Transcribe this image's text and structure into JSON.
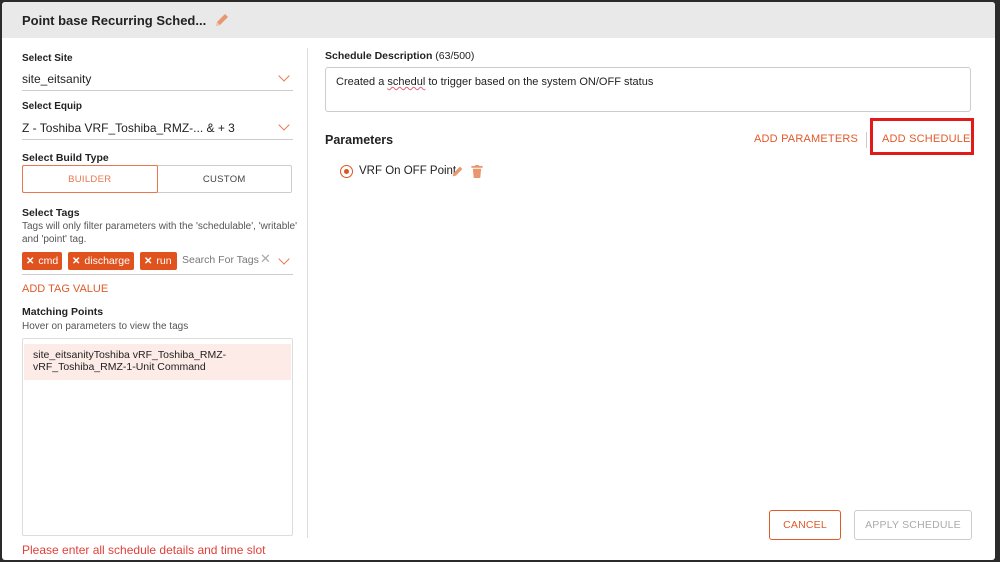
{
  "header": {
    "title": "Point base Recurring Sched..."
  },
  "left": {
    "site_label": "Select Site",
    "site_value": "site_eitsanity",
    "equip_label": "Select Equip",
    "equip_value": "Z - Toshiba VRF_Toshiba_RMZ-... & + 3",
    "build_label": "Select Build Type",
    "build_options": [
      "BUILDER",
      "CUSTOM"
    ],
    "tags_label": "Select Tags",
    "tags_hint": "Tags will only filter parameters with the 'schedulable', 'writable' and 'point' tag.",
    "tags": [
      "cmd",
      "discharge",
      "run"
    ],
    "tags_placeholder": "Search For Tags",
    "add_tag_value": "ADD TAG VALUE",
    "matching_label": "Matching Points",
    "matching_hint": "Hover on parameters to view the tags",
    "matching_points": [
      "site_eitsanityToshiba vRF_Toshiba_RMZ-vRF_Toshiba_RMZ-1-Unit Command"
    ],
    "error": "Please enter all schedule details and time slot value"
  },
  "right": {
    "desc_label": "Schedule Description",
    "desc_count": "(63/500)",
    "desc_before": "Created a ",
    "desc_misspelled": "schedul",
    "desc_after": " to trigger based on the system  ON/OFF status",
    "params_title": "Parameters",
    "add_parameters": "ADD PARAMETERS",
    "add_schedule": "ADD SCHEDULE",
    "parameter": "VRF On OFF Point",
    "cancel": "CANCEL",
    "apply": "APPLY SCHEDULE"
  },
  "colors": {
    "accent": "#e05a2a",
    "chip": "#e0531f",
    "highlight": "#e11a1a",
    "error": "#e0413a"
  },
  "icons": [
    "pencil-icon",
    "chevron-down-icon",
    "close-icon",
    "trash-icon",
    "radio-selected-icon"
  ]
}
